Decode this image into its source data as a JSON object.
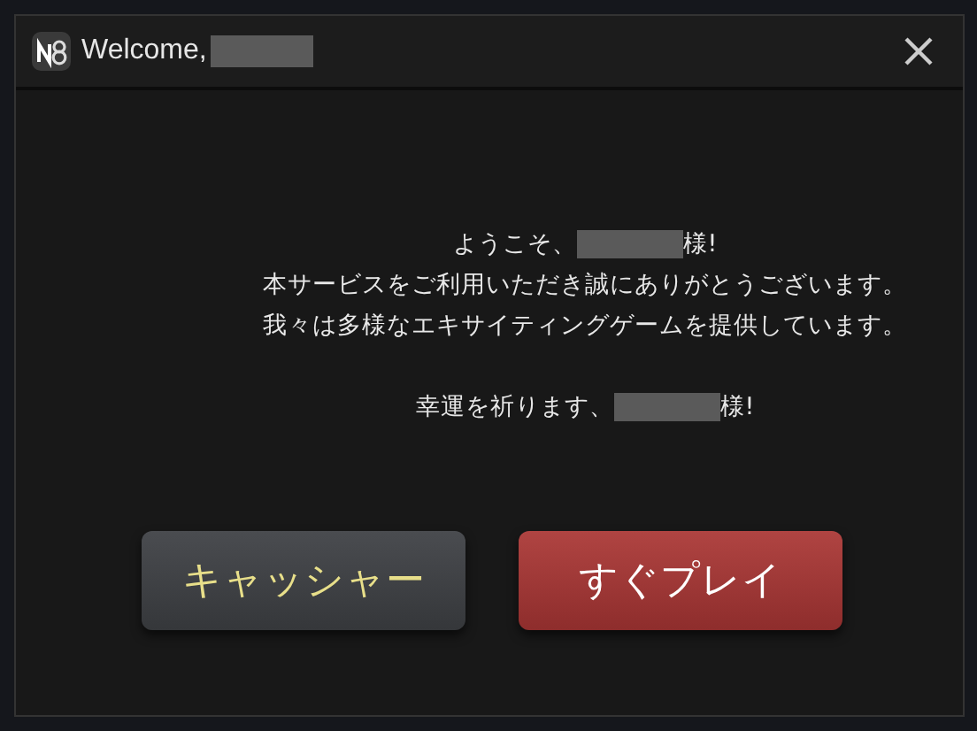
{
  "window": {
    "title": "Welcome,",
    "title_redacted": true
  },
  "message": [
    {
      "text": "ようこそ、",
      "redacted": true,
      "after": "様!"
    },
    {
      "text": "本サービスをご利用いただき誠にありがとうございます。",
      "redacted": false
    },
    {
      "text": "我々は多様なエキサイティングゲームを提供しています。",
      "redacted": false
    },
    {
      "text": "幸運を祈ります、",
      "redacted": true,
      "after": "様!",
      "gap_before": true
    }
  ],
  "buttons": [
    {
      "label": "キャッシャー",
      "kind": "secondary"
    },
    {
      "label": "すぐプレイ",
      "kind": "primary"
    }
  ]
}
